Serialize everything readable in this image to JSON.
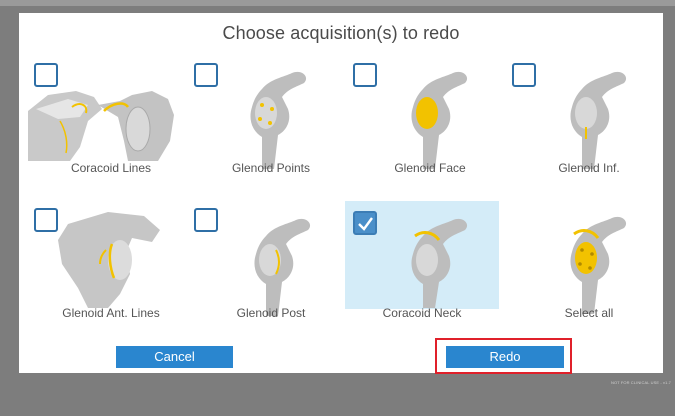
{
  "dialog": {
    "title": "Choose acquisition(s) to redo"
  },
  "options": [
    {
      "label": "Coracoid Lines",
      "checked": false
    },
    {
      "label": "Glenoid Points",
      "checked": false
    },
    {
      "label": "Glenoid Face",
      "checked": false
    },
    {
      "label": "Glenoid Inf.",
      "checked": false
    },
    {
      "label": "Glenoid Ant. Lines",
      "checked": false
    },
    {
      "label": "Glenoid Post",
      "checked": false
    },
    {
      "label": "Coracoid Neck",
      "checked": true
    },
    {
      "label": "Select all",
      "checked": false
    }
  ],
  "buttons": {
    "cancel": "Cancel",
    "redo": "Redo"
  },
  "footer": {
    "note": "NOT FOR CLINICAL USE - v1.7"
  },
  "colors": {
    "accent": "#2a86cf",
    "highlight_outline": "#e0202a",
    "selected_bg": "#d4ecf8",
    "bone_marker": "#f2c200"
  }
}
